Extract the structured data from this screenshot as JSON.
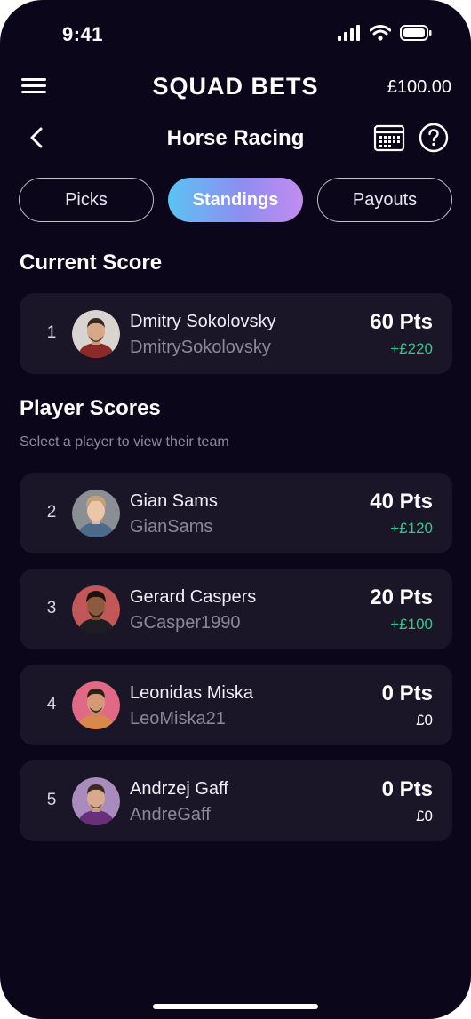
{
  "status": {
    "time": "9:41"
  },
  "header": {
    "app_title": "SQUAD BETS",
    "balance": "£100.00"
  },
  "subheader": {
    "title": "Horse Racing"
  },
  "tabs": [
    {
      "label": "Picks",
      "active": false
    },
    {
      "label": "Standings",
      "active": true
    },
    {
      "label": "Payouts",
      "active": false
    }
  ],
  "current_score": {
    "title": "Current Score",
    "entry": {
      "rank": "1",
      "name": "Dmitry Sokolovsky",
      "username": "DmitrySokolovsky",
      "points": "60 Pts",
      "payout": "+£220"
    }
  },
  "player_scores": {
    "title": "Player Scores",
    "subtitle": "Select a player to view their team",
    "entries": [
      {
        "rank": "2",
        "name": "Gian Sams",
        "username": "GianSams",
        "points": "40 Pts",
        "payout": "+£120"
      },
      {
        "rank": "3",
        "name": "Gerard Caspers",
        "username": "GCasper1990",
        "points": "20 Pts",
        "payout": "+£100"
      },
      {
        "rank": "4",
        "name": "Leonidas Miska",
        "username": "LeoMiska21",
        "points": "0 Pts",
        "payout": "£0"
      },
      {
        "rank": "5",
        "name": "Andrzej Gaff",
        "username": "AndreGaff",
        "points": "0 Pts",
        "payout": "£0"
      }
    ]
  },
  "colors": {
    "background": "#0b0619",
    "card": "#1a1628",
    "positive": "#2fc98a",
    "muted": "#8c889a",
    "accent_gradient": [
      "#5bc3f2",
      "#8f8df0",
      "#c38cf0"
    ]
  },
  "icons": [
    "signal-icon",
    "wifi-icon",
    "battery-icon",
    "menu-icon",
    "back-arrow-icon",
    "calendar-icon",
    "help-icon"
  ]
}
